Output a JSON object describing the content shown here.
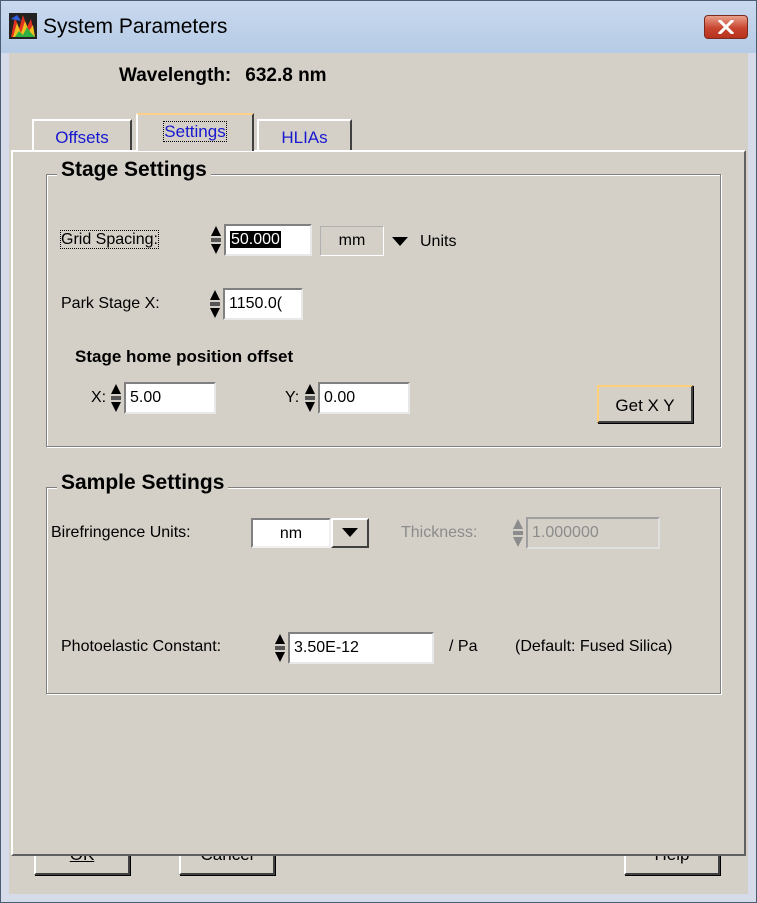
{
  "window": {
    "title": "System Parameters",
    "close_icon": "close-x-icon"
  },
  "header": {
    "wavelength_label": "Wavelength:",
    "wavelength_value": "632.8 nm"
  },
  "tabs": [
    {
      "label": "Offsets",
      "active": false
    },
    {
      "label": "Settings",
      "active": true
    },
    {
      "label": "HLIAs",
      "active": false
    }
  ],
  "stage_settings": {
    "title": "Stage Settings",
    "grid_spacing_label": "Grid Spacing:",
    "grid_spacing_value": "50.000",
    "units_selected": "mm",
    "units_label": "Units",
    "park_stage_label": "Park Stage X:",
    "park_stage_value": "1150.0(",
    "home_offset_label": "Stage home position offset",
    "x_label": "X:",
    "x_value": "5.00",
    "y_label": "Y:",
    "y_value": "0.00",
    "get_xy_button": "Get X Y"
  },
  "sample_settings": {
    "title": "Sample Settings",
    "birefringence_label": "Birefringence Units:",
    "birefringence_selected": "nm",
    "thickness_label": "Thickness:",
    "thickness_value": "1.000000",
    "photoelastic_label": "Photoelastic Constant:",
    "photoelastic_value": "3.50E-12",
    "photoelastic_unit": "/ Pa",
    "photoelastic_default": "(Default: Fused Silica)"
  },
  "footer": {
    "ok": "OK",
    "cancel": "Cancel",
    "help": "Help"
  },
  "colors": {
    "tab_text": "#1818d0",
    "panel_bg": "#d4d0c8",
    "close_button": "#c8452f"
  }
}
